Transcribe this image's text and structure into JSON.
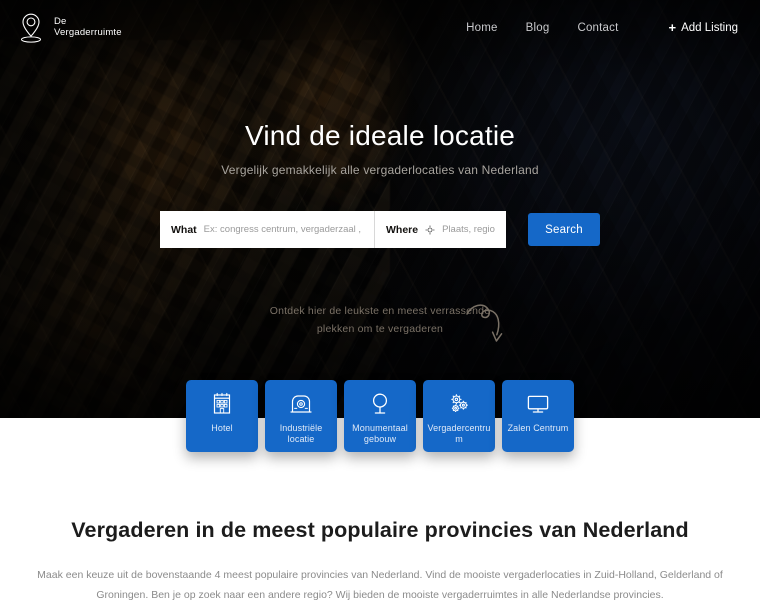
{
  "header": {
    "logo": {
      "icon": "map-pin-icon",
      "line1": "De",
      "line2": "Vergaderruimte"
    },
    "nav": [
      {
        "label": "Home"
      },
      {
        "label": "Blog"
      },
      {
        "label": "Contact"
      }
    ],
    "cta": {
      "icon": "plus-icon",
      "label": "Add Listing"
    }
  },
  "hero": {
    "title": "Vind de ideale locatie",
    "subtitle": "Vergelijk gemakkelijk alle vergaderlocaties van Nederland"
  },
  "search": {
    "what_label": "What",
    "what_placeholder": "Ex: congress centrum, vergaderzaal , restaurant",
    "what_value": "",
    "where_label": "Where",
    "where_icon": "crosshair-locate-icon",
    "where_placeholder": "Plaats, regio of provi",
    "where_value": "",
    "button_label": "Search",
    "button_color": "#1568c8"
  },
  "discover": {
    "text": "Ontdek hier de leukste en meest verrassende plekken om te vergaderen",
    "arrow_icon": "curved-arrow-icon"
  },
  "categories": [
    {
      "label": "Hotel",
      "icon": "hotel-building-icon"
    },
    {
      "label": "Industriële locatie",
      "icon": "factory-icon"
    },
    {
      "label": "Monumentaal gebouw",
      "icon": "monument-icon"
    },
    {
      "label": "Vergadercentrum",
      "icon": "gears-icon"
    },
    {
      "label": "Zalen Centrum",
      "icon": "monitor-icon"
    }
  ],
  "bottom": {
    "title": "Vergaderen in de meest populaire provincies van Nederland",
    "body": "Maak een keuze uit de bovenstaande 4 meest populaire provincies van Nederland. Vind de mooiste vergaderlocaties in Zuid-Holland, Gelderland of Groningen. Ben je op zoek naar een andere regio? Wij bieden de mooiste vergaderruimtes in alle Nederlandse provincies."
  },
  "colors": {
    "accent": "#1568c8",
    "hero_background": "#0a0906",
    "page_background": "#ffffff"
  }
}
